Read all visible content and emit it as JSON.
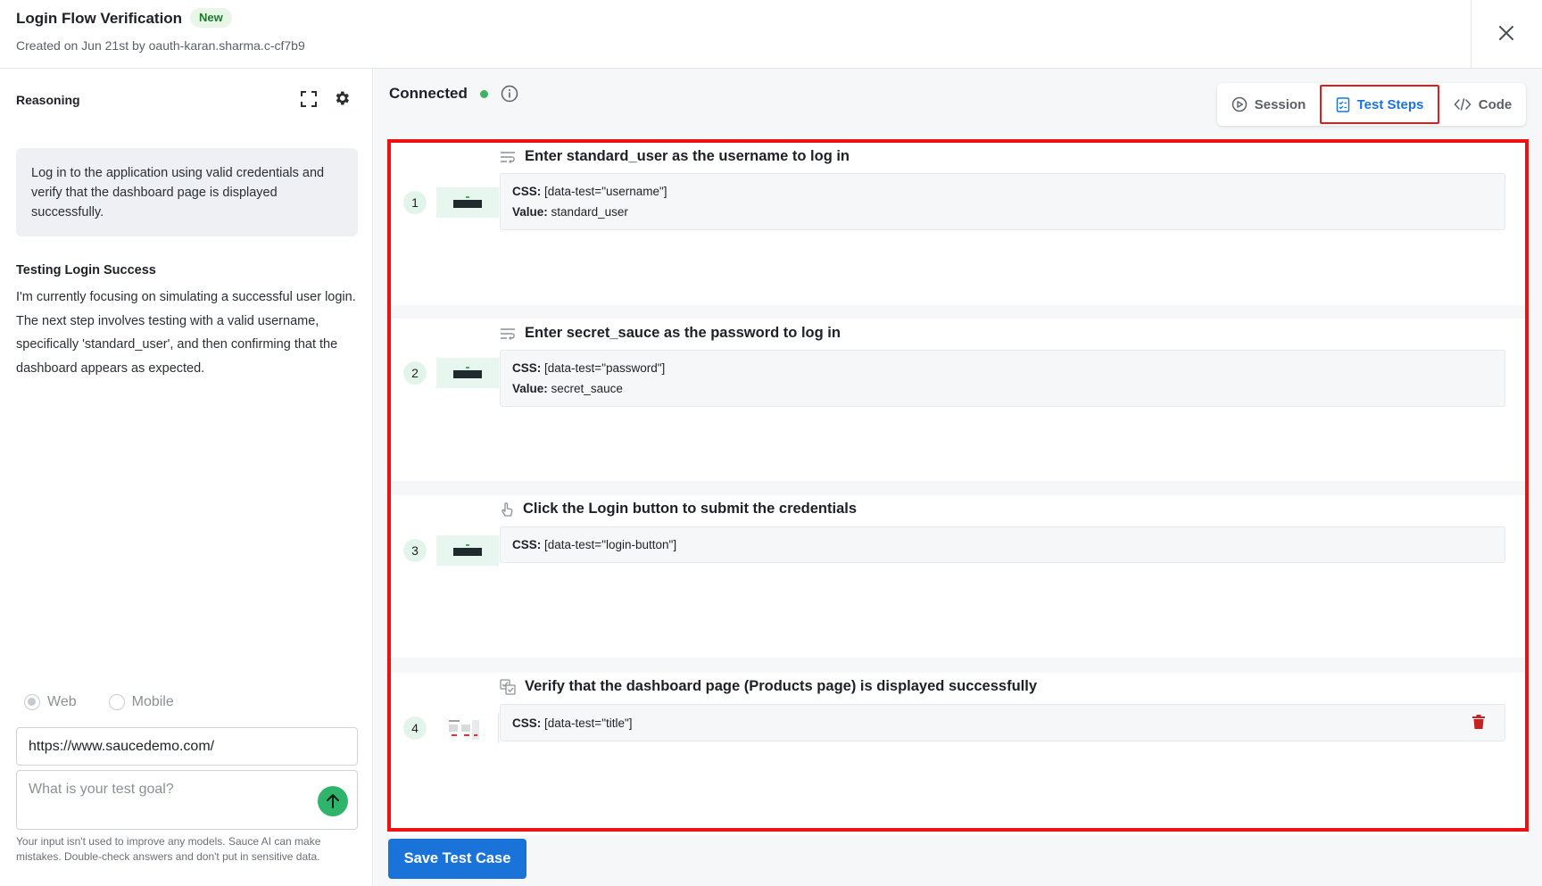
{
  "header": {
    "title": "Login Flow Verification",
    "badge": "New",
    "subtitle": "Created on Jun 21st by oauth-karan.sharma.c-cf7b9"
  },
  "left": {
    "reasoning_title": "Reasoning",
    "goal": "Log in to the application using valid credentials and verify that the dashboard page is displayed successfully.",
    "section_title": "Testing Login Success",
    "section_body": "I'm currently focusing on simulating a successful user login. The next step involves testing with a valid username, specifically 'standard_user', and then confirming that the dashboard appears as expected.",
    "radio_web": "Web",
    "radio_mobile": "Mobile",
    "url_value": "https://www.saucedemo.com/",
    "goal_placeholder": "What is your test goal?",
    "disclaimer": "Your input isn't used to improve any models. Sauce AI can make mistakes. Double-check answers and don't put in sensitive data."
  },
  "right": {
    "connection_label": "Connected",
    "tabs": {
      "session": "Session",
      "test_steps": "Test Steps",
      "code": "Code"
    },
    "steps": [
      {
        "number": "1",
        "title": "Enter standard_user as the username to log in",
        "css_label": "CSS:",
        "css": "[data-test=\"username\"]",
        "value_label": "Value:",
        "value": "standard_user"
      },
      {
        "number": "2",
        "title": "Enter secret_sauce as the password to log in",
        "css_label": "CSS:",
        "css": "[data-test=\"password\"]",
        "value_label": "Value:",
        "value": "secret_sauce"
      },
      {
        "number": "3",
        "title": "Click the Login button to submit the credentials",
        "css_label": "CSS:",
        "css": "[data-test=\"login-button\"]"
      },
      {
        "number": "4",
        "title": "Verify that the dashboard page (Products page) is displayed successfully",
        "css_label": "CSS:",
        "css": "[data-test=\"title\"]"
      }
    ],
    "save_button": "Save Test Case"
  },
  "colors": {
    "accent": "#1a73d9",
    "highlight": "#ee1111",
    "connected": "#3db361",
    "send": "#2eb56b",
    "delete": "#c62020"
  }
}
